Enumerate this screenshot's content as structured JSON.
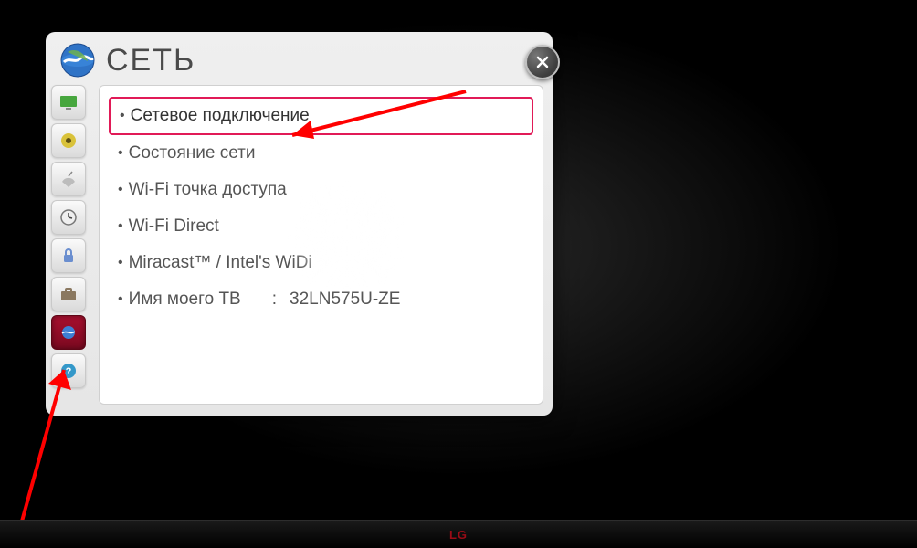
{
  "brand": "LG",
  "window": {
    "title": "СЕТЬ",
    "close_label": "Close"
  },
  "sidebar": {
    "items": [
      {
        "name": "picture",
        "selected": false
      },
      {
        "name": "sound",
        "selected": false
      },
      {
        "name": "channel",
        "selected": false
      },
      {
        "name": "time",
        "selected": false
      },
      {
        "name": "lock",
        "selected": false
      },
      {
        "name": "option",
        "selected": false
      },
      {
        "name": "network",
        "selected": true
      },
      {
        "name": "support",
        "selected": false
      }
    ]
  },
  "menu": {
    "items": [
      {
        "label": "Сетевое подключение",
        "value": "",
        "selected": true
      },
      {
        "label": "Состояние сети",
        "value": "",
        "selected": false
      },
      {
        "label": "Wi-Fi точка доступа",
        "value": "",
        "selected": false
      },
      {
        "label": "Wi-Fi Direct",
        "value": "",
        "selected": false
      },
      {
        "label": "Miracast™ / Intel's WiDi",
        "value": "",
        "selected": false
      },
      {
        "label": "Имя моего ТВ",
        "value": "32LN575U-ZE",
        "selected": false
      }
    ]
  }
}
